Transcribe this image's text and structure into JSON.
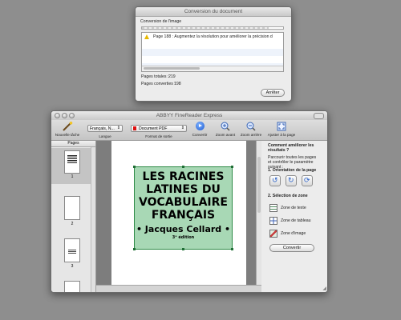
{
  "conversion_dialog": {
    "title": "Conversion du document",
    "section_label": "Conversion de l'image",
    "warning_message": "Page 188 : Augmentez la résolution pour améliorer la précision d",
    "total_pages_label": "Pages totales :",
    "total_pages_value": "219",
    "converted_pages_label": "Pages converties :",
    "converted_pages_value": "198",
    "progress": 0.9,
    "stop_button": "Arrêter"
  },
  "main_window": {
    "title": "ABBYY FineReader Express",
    "toolbar": {
      "new_task": "Nouvelle tâche",
      "language_label": "Langue",
      "language_value": "Français, N...",
      "output_format_label": "Format de sortie",
      "output_format_value": "Document PDF",
      "convert_label": "Convertir",
      "zoom_in": "Zoom avant",
      "zoom_out": "Zoom arrière",
      "fit_page": "Ajuster à la page"
    },
    "pages_panel": {
      "header": "Pages",
      "pages": [
        "1",
        "2",
        "3"
      ]
    },
    "document": {
      "title_lines": [
        "LES RACINES",
        "LATINES DU",
        "VOCABULAIRE",
        "FRANÇAIS"
      ],
      "author": "• Jacques Cellard •",
      "edition": "3ᵉ édition"
    },
    "side_panel": {
      "heading": "Comment améliorer les résultats ?",
      "instructions": "Parcourir toutes les pages et contrôler le paramètre suivant :",
      "step1": "1. Orientation de la page",
      "step2": "2. Sélection de zone",
      "zone_text": "Zone de texte",
      "zone_table": "Zone de tableau",
      "zone_image": "Zone d'image",
      "convert_button": "Convertir"
    }
  }
}
